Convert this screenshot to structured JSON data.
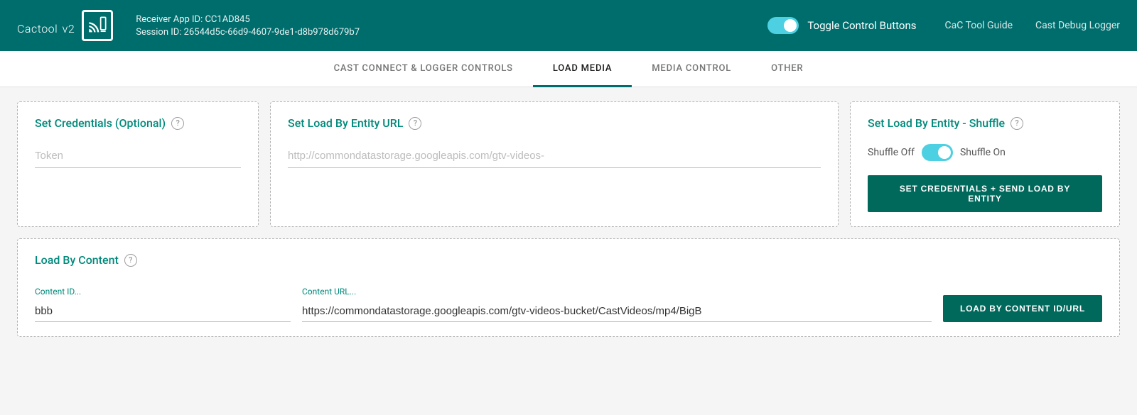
{
  "header": {
    "logo_text": "Cactool",
    "logo_version": "v2",
    "receiver_app_id_label": "Receiver App ID: CC1AD845",
    "session_id_label": "Session ID: 26544d5c-66d9-4607-9de1-d8b978d679b7",
    "toggle_label": "Toggle Control Buttons",
    "nav": {
      "guide_label": "CaC Tool Guide",
      "logger_label": "Cast Debug Logger"
    }
  },
  "tabs": [
    {
      "id": "cast-connect",
      "label": "CAST CONNECT & LOGGER CONTROLS",
      "active": false
    },
    {
      "id": "load-media",
      "label": "LOAD MEDIA",
      "active": true
    },
    {
      "id": "media-control",
      "label": "MEDIA CONTROL",
      "active": false
    },
    {
      "id": "other",
      "label": "OTHER",
      "active": false
    }
  ],
  "credentials_card": {
    "title": "Set Credentials (Optional)",
    "token_placeholder": "Token"
  },
  "entity_url_card": {
    "title": "Set Load By Entity URL",
    "url_placeholder": "http://commondatastorage.googleapis.com/gtv-videos-"
  },
  "shuffle_card": {
    "title": "Set Load By Entity - Shuffle",
    "shuffle_off_label": "Shuffle Off",
    "shuffle_on_label": "Shuffle On",
    "button_label": "SET CREDENTIALS + SEND LOAD BY ENTITY"
  },
  "load_content_card": {
    "title": "Load By Content",
    "content_id_label": "Content ID...",
    "content_id_value": "bbb",
    "content_url_label": "Content URL...",
    "content_url_value": "https://commondatastorage.googleapis.com/gtv-videos-bucket/CastVideos/mp4/BigB",
    "button_label": "LOAD BY CONTENT ID/URL"
  },
  "colors": {
    "teal_dark": "#006d6d",
    "teal_accent": "#00897b",
    "toggle_blue": "#4dd0e1"
  }
}
